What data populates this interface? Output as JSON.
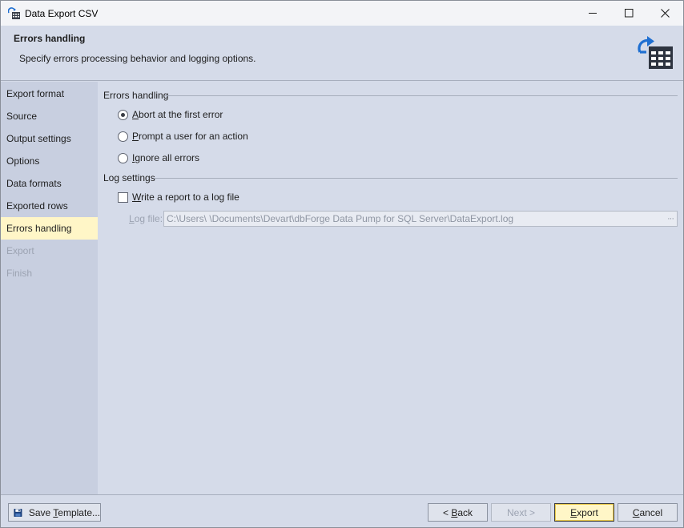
{
  "window": {
    "title": "Data Export CSV",
    "minimize_icon": "minimize-icon",
    "maximize_icon": "maximize-icon",
    "close_icon": "close-icon"
  },
  "header": {
    "title": "Errors handling",
    "subtitle": "Specify errors processing behavior and logging options.",
    "icon": "export-table-icon"
  },
  "sidebar": {
    "items": [
      {
        "label": "Export format",
        "state": "normal"
      },
      {
        "label": "Source",
        "state": "normal"
      },
      {
        "label": "Output settings",
        "state": "normal"
      },
      {
        "label": "Options",
        "state": "normal"
      },
      {
        "label": "Data formats",
        "state": "normal"
      },
      {
        "label": "Exported rows",
        "state": "normal"
      },
      {
        "label": "Errors handling",
        "state": "active"
      },
      {
        "label": "Export",
        "state": "disabled"
      },
      {
        "label": "Finish",
        "state": "disabled"
      }
    ]
  },
  "errors_group": {
    "label": "Errors handling",
    "options": [
      {
        "mnemonic": "A",
        "rest": "bort at the first error",
        "checked": true
      },
      {
        "mnemonic": "P",
        "rest": "rompt a user for an action",
        "checked": false
      },
      {
        "mnemonic": "I",
        "rest": "gnore all errors",
        "checked": false
      }
    ]
  },
  "log_group": {
    "label": "Log settings",
    "write_report": {
      "mnemonic": "W",
      "rest": "rite a report to a log file",
      "checked": false
    },
    "log_file_label_mnemonic": "L",
    "log_file_label_rest": "og file:",
    "log_file_value": "C:\\Users\\        \\Documents\\Devart\\dbForge Data Pump for SQL Server\\DataExport.log",
    "browse_label": "···"
  },
  "footer": {
    "save_template": "Save Template...",
    "save_mnemonic_pre": "Save ",
    "save_mnemonic": "T",
    "save_mnemonic_post": "emplate...",
    "back_pre": "< ",
    "back_mnemonic": "B",
    "back_post": "ack",
    "next_label": "Next >",
    "export_mnemonic": "E",
    "export_post": "xport",
    "cancel_mnemonic": "C",
    "cancel_post": "ancel"
  },
  "colors": {
    "accent_active": "#fff6c7",
    "panel_bg": "#d5dbe9",
    "sidebar_bg": "#c8cfe0"
  }
}
